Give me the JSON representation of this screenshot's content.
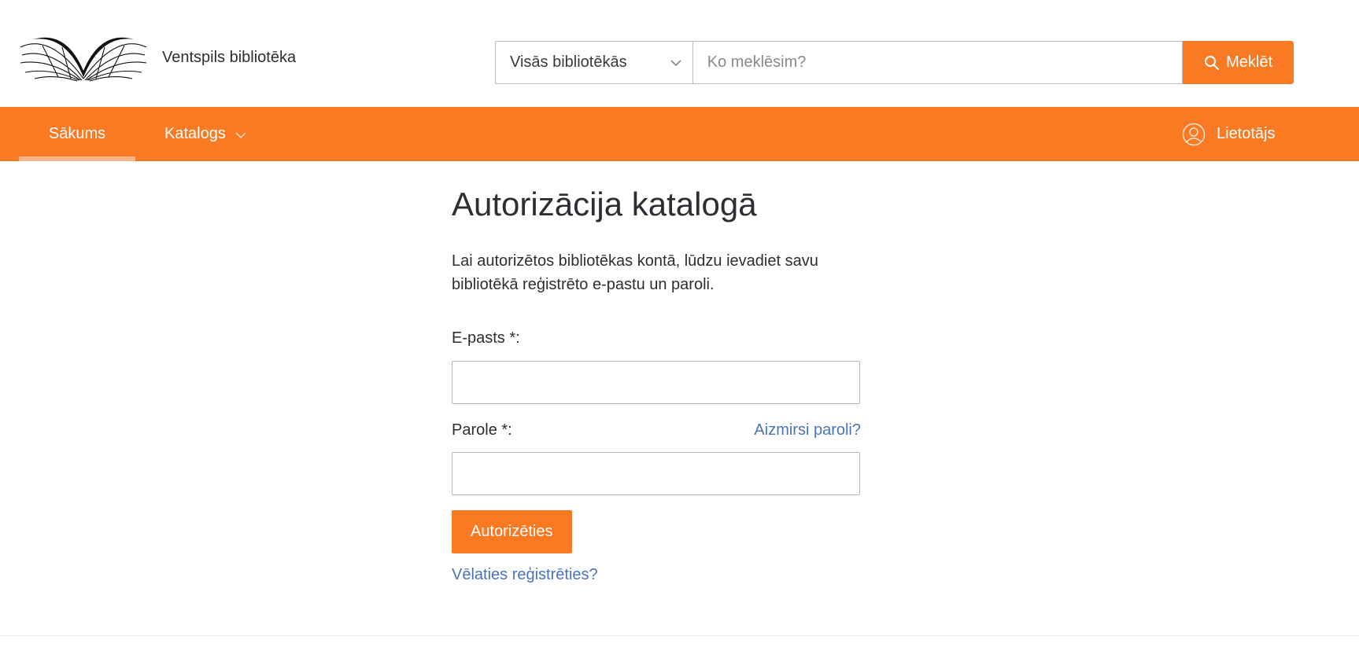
{
  "header": {
    "brand_name": "Ventspils bibliotēka",
    "logo_icon": "open-book-logo",
    "search": {
      "scope_selected": "Visās bibliotēkās",
      "placeholder": "Ko meklēsim?",
      "button_label": "Meklēt"
    }
  },
  "nav": {
    "items": [
      {
        "label": "Sākums",
        "active": true
      },
      {
        "label": "Katalogs",
        "has_dropdown": true
      }
    ],
    "user_label": "Lietotājs"
  },
  "main": {
    "title": "Autorizācija katalogā",
    "intro": "Lai autorizētos bibliotēkas kontā, lūdzu ievadiet savu bibliotēkā reģistrēto e-pastu un paroli.",
    "email_label": "E-pasts *:",
    "email_value": "",
    "password_label": "Parole *:",
    "password_value": "",
    "forgot_link": "Aizmirsi paroli?",
    "submit_label": "Autorizēties",
    "register_link": "Vēlaties reģistrēties?"
  },
  "colors": {
    "accent": "#f97a22",
    "link": "#4a73b8",
    "text": "#2b2f33"
  }
}
